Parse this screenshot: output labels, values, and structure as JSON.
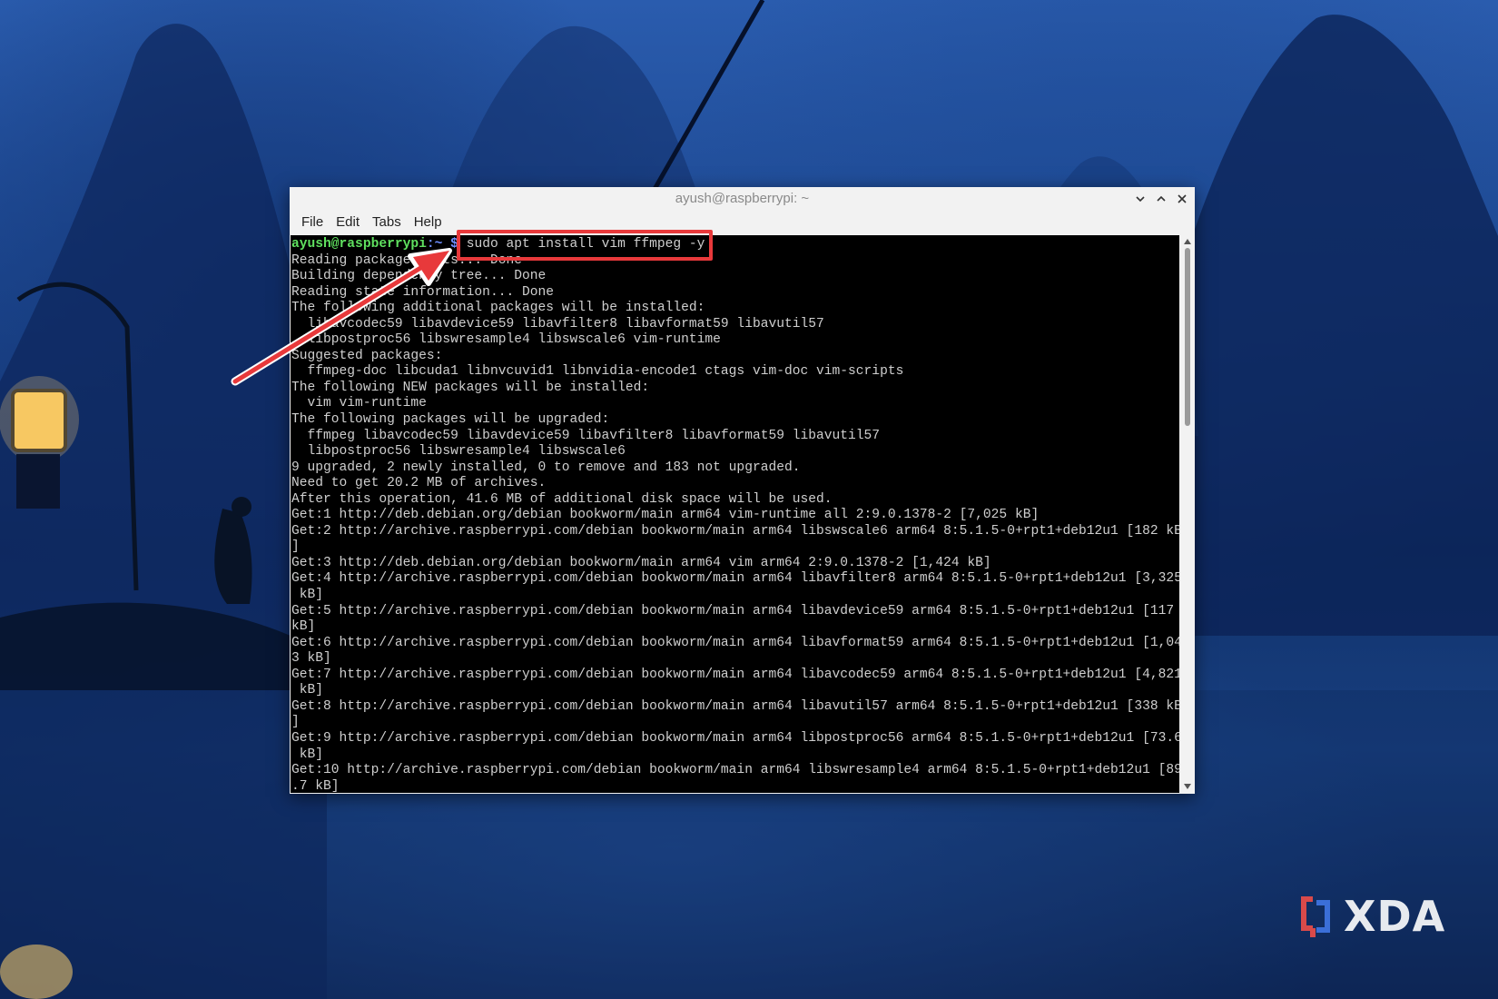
{
  "window": {
    "title": "ayush@raspberrypi: ~",
    "controls": [
      "chevron-down-icon",
      "chevron-up-icon",
      "close-icon"
    ]
  },
  "menubar": {
    "items": [
      "File",
      "Edit",
      "Tabs",
      "Help"
    ]
  },
  "terminal": {
    "prompt_user": "ayush@raspberrypi",
    "prompt_path": ":~ $",
    "command": "sudo apt install vim ffmpeg -y",
    "output": [
      "Reading package lists... Done",
      "Building dependency tree... Done",
      "Reading state information... Done",
      "The following additional packages will be installed:",
      "  libavcodec59 libavdevice59 libavfilter8 libavformat59 libavutil57",
      "  libpostproc56 libswresample4 libswscale6 vim-runtime",
      "Suggested packages:",
      "  ffmpeg-doc libcuda1 libnvcuvid1 libnvidia-encode1 ctags vim-doc vim-scripts",
      "The following NEW packages will be installed:",
      "  vim vim-runtime",
      "The following packages will be upgraded:",
      "  ffmpeg libavcodec59 libavdevice59 libavfilter8 libavformat59 libavutil57",
      "  libpostproc56 libswresample4 libswscale6",
      "9 upgraded, 2 newly installed, 0 to remove and 183 not upgraded.",
      "Need to get 20.2 MB of archives.",
      "After this operation, 41.6 MB of additional disk space will be used.",
      "Get:1 http://deb.debian.org/debian bookworm/main arm64 vim-runtime all 2:9.0.1378-2 [7,025 kB]",
      "Get:2 http://archive.raspberrypi.com/debian bookworm/main arm64 libswscale6 arm64 8:5.1.5-0+rpt1+deb12u1 [182 kB",
      "]",
      "Get:3 http://deb.debian.org/debian bookworm/main arm64 vim arm64 2:9.0.1378-2 [1,424 kB]",
      "Get:4 http://archive.raspberrypi.com/debian bookworm/main arm64 libavfilter8 arm64 8:5.1.5-0+rpt1+deb12u1 [3,325",
      " kB]",
      "Get:5 http://archive.raspberrypi.com/debian bookworm/main arm64 libavdevice59 arm64 8:5.1.5-0+rpt1+deb12u1 [117",
      "kB]",
      "Get:6 http://archive.raspberrypi.com/debian bookworm/main arm64 libavformat59 arm64 8:5.1.5-0+rpt1+deb12u1 [1,04",
      "3 kB]",
      "Get:7 http://archive.raspberrypi.com/debian bookworm/main arm64 libavcodec59 arm64 8:5.1.5-0+rpt1+deb12u1 [4,821",
      " kB]",
      "Get:8 http://archive.raspberrypi.com/debian bookworm/main arm64 libavutil57 arm64 8:5.1.5-0+rpt1+deb12u1 [338 kB",
      "]",
      "Get:9 http://archive.raspberrypi.com/debian bookworm/main arm64 libpostproc56 arm64 8:5.1.5-0+rpt1+deb12u1 [73.6",
      " kB]",
      "Get:10 http://archive.raspberrypi.com/debian bookworm/main arm64 libswresample4 arm64 8:5.1.5-0+rpt1+deb12u1 [89",
      ".7 kB]"
    ]
  },
  "annotation": {
    "highlight_color": "#e8393b"
  },
  "watermark": {
    "text": "XDA"
  }
}
